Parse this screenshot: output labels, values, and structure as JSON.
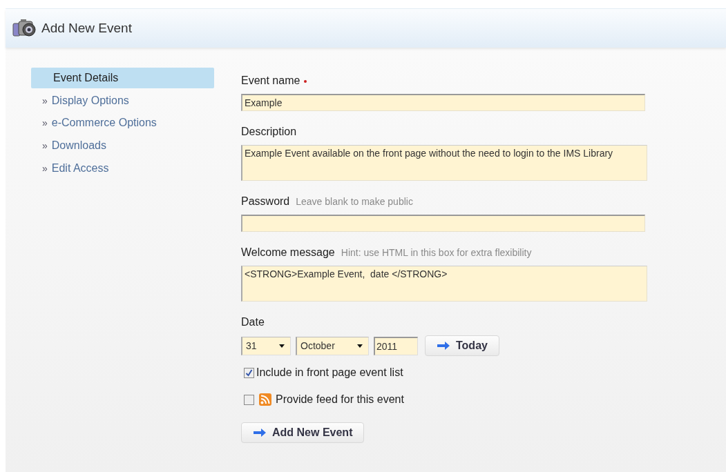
{
  "header": {
    "title": "Add New Event"
  },
  "sidebar": {
    "items": [
      {
        "label": "Event Details",
        "selected": true
      },
      {
        "marker": "»",
        "label": "Display Options",
        "selected": false
      },
      {
        "marker": "»",
        "label": "e-Commerce Options",
        "selected": false
      },
      {
        "marker": "»",
        "label": "Downloads",
        "selected": false
      },
      {
        "marker": "»",
        "label": "Edit Access",
        "selected": false
      }
    ]
  },
  "fields": [
    {
      "kind": "text",
      "label": "Event name",
      "required": true,
      "value": "Example"
    },
    {
      "kind": "textarea",
      "label": "Description",
      "required": false,
      "value": "Example Event available on the front page without the need to login to the IMS Library"
    },
    {
      "kind": "text",
      "label": "Password",
      "required": false,
      "hint": "Leave blank to make public"
    },
    {
      "kind": "textarea",
      "label": "Welcome message",
      "required": false,
      "hint": "Hint: use HTML in this box for extra flexibility",
      "value": "<STRONG>Example Event,  date </STRONG>"
    }
  ],
  "date": {
    "label": "Date",
    "day": "31",
    "month": "October",
    "year": "2011",
    "today_button": "Today"
  },
  "options": [
    {
      "kind": "plain",
      "label": "Include in front page event list",
      "checked": true
    },
    {
      "kind": "feed",
      "label": "Provide feed for this event",
      "checked": false
    }
  ],
  "submit": {
    "label": "Add New Event"
  }
}
